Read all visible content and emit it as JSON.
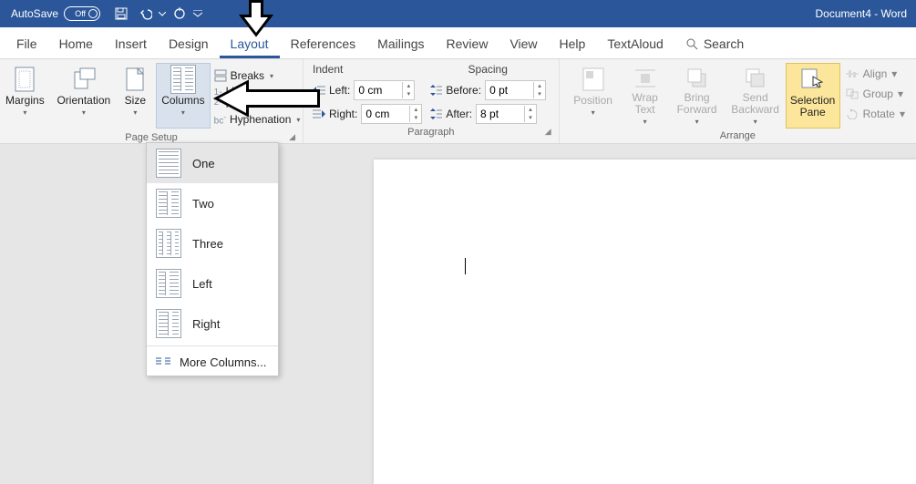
{
  "titlebar": {
    "autosave_label": "AutoSave",
    "autosave_state": "Off",
    "document_title": "Document4 - Word"
  },
  "tabs": {
    "file": "File",
    "home": "Home",
    "insert": "Insert",
    "design": "Design",
    "layout": "Layout",
    "references": "References",
    "mailings": "Mailings",
    "review": "Review",
    "view": "View",
    "help": "Help",
    "textaloud": "TextAloud",
    "search": "Search"
  },
  "ribbon": {
    "page_setup": {
      "margins": "Margins",
      "orientation": "Orientation",
      "size": "Size",
      "columns": "Columns",
      "breaks": "Breaks",
      "line_numbers": "Line Numbers",
      "hyphenation": "Hyphenation",
      "group_label": "Page Setup"
    },
    "paragraph": {
      "indent_label": "Indent",
      "spacing_label": "Spacing",
      "left_label": "Left:",
      "right_label": "Right:",
      "before_label": "Before:",
      "after_label": "After:",
      "left_value": "0 cm",
      "right_value": "0 cm",
      "before_value": "0 pt",
      "after_value": "8 pt",
      "group_label": "Paragraph"
    },
    "arrange": {
      "position": "Position",
      "wrap_text": "Wrap Text",
      "bring_forward": "Bring Forward",
      "send_backward": "Send Backward",
      "selection_pane": "Selection Pane",
      "align": "Align",
      "group": "Group",
      "rotate": "Rotate",
      "group_label": "Arrange"
    }
  },
  "columns_menu": {
    "one": "One",
    "two": "Two",
    "three": "Three",
    "left": "Left",
    "right": "Right",
    "more": "More Columns..."
  }
}
